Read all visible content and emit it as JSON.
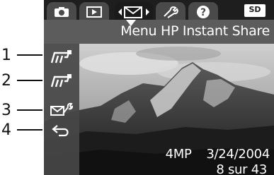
{
  "callouts": [
    "1",
    "2",
    "3",
    "4"
  ],
  "tabs": [
    {
      "icon": "camera-icon",
      "active": false
    },
    {
      "icon": "playback-icon",
      "active": false
    },
    {
      "icon": "share-envelope-icon",
      "active": true
    },
    {
      "icon": "setup-wrench-icon",
      "active": false
    },
    {
      "icon": "help-icon",
      "active": false
    }
  ],
  "memory_badge": "SD",
  "menu_title": "Menu HP Instant Share",
  "menu_items": [
    {
      "icon": "hp-destination-1-icon"
    },
    {
      "icon": "hp-destination-2-icon"
    },
    {
      "icon": "share-setup-icon"
    },
    {
      "icon": "back-arrow-icon"
    }
  ],
  "photo_info": {
    "resolution": "4MP",
    "date": "3/24/2004",
    "counter": "8 sur 43"
  },
  "colors": {
    "tab_bar": "#1e1e1e",
    "tab": "#4a4a4a",
    "title_bar": "#5c5c5c",
    "sidebar": "#464646",
    "text": "#ffffff"
  }
}
